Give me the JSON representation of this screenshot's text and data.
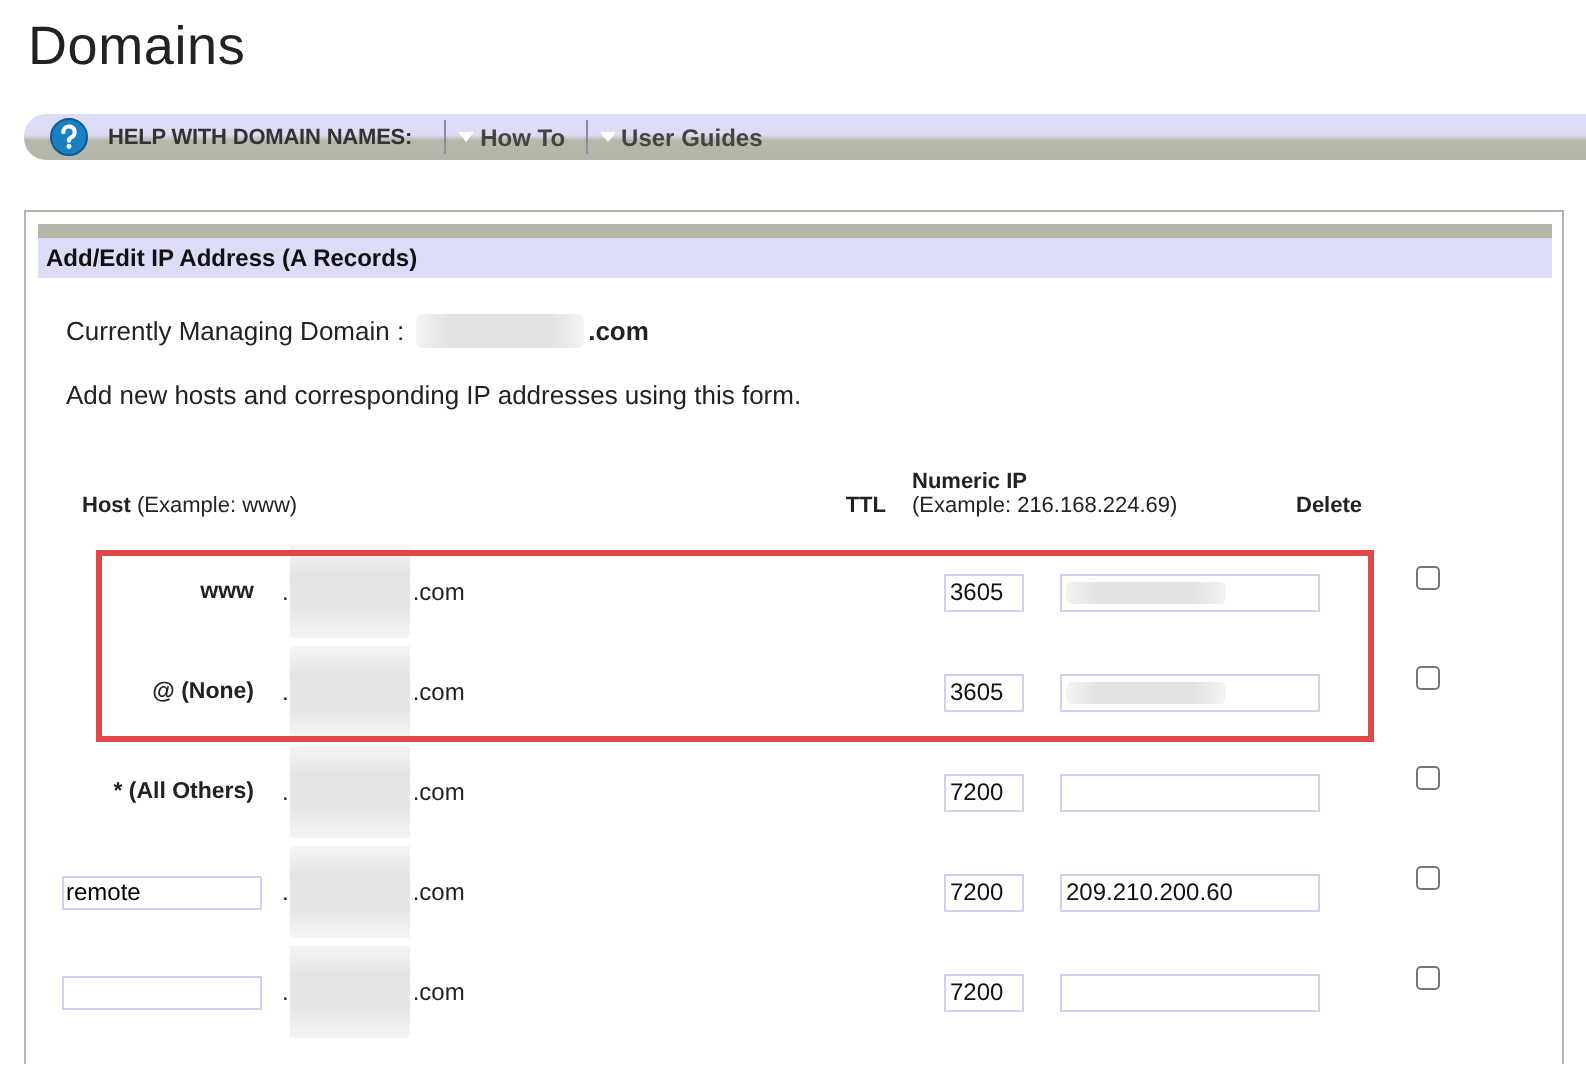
{
  "page": {
    "title": "Domains"
  },
  "help_bar": {
    "label": "HELP WITH DOMAIN NAMES:",
    "links": [
      "How To",
      "User Guides"
    ]
  },
  "panel": {
    "title": "Add/Edit IP Address (A Records)",
    "managing_label": "Currently Managing Domain :",
    "managing_suffix": ".com",
    "intro": "Add new hosts and corresponding IP addresses using this form."
  },
  "columns": {
    "host": "Host",
    "host_hint": "(Example: www)",
    "ttl": "TTL",
    "ip": "Numeric IP",
    "ip_hint": "(Example: 216.168.224.69)",
    "delete": "Delete"
  },
  "rows": [
    {
      "kind": "fixed",
      "host": "www",
      "domain_prefix": ".",
      "domain_suffix": ".com",
      "ttl": "3605",
      "ip_redacted": true,
      "delete_checked": false,
      "highlighted": true
    },
    {
      "kind": "fixed",
      "host": "@ (None)",
      "domain_prefix": ".",
      "domain_suffix": ".com",
      "ttl": "3605",
      "ip_redacted": true,
      "delete_checked": false,
      "highlighted": true
    },
    {
      "kind": "fixed",
      "host": "* (All Others)",
      "domain_prefix": ".",
      "domain_suffix": ".com",
      "ttl": "7200",
      "ip_redacted": false,
      "delete_checked": false,
      "highlighted": false
    },
    {
      "kind": "input",
      "host": "remote",
      "domain_prefix": ".",
      "domain_suffix": ".com",
      "ttl": "7200",
      "ip": "209.210.200.60",
      "ip_redacted": false,
      "delete_checked": false,
      "highlighted": false
    },
    {
      "kind": "input",
      "domain_prefix": ".",
      "domain_suffix": ".com",
      "ttl": "7200",
      "ip_redacted": false,
      "delete_checked": false,
      "highlighted": false
    }
  ]
}
